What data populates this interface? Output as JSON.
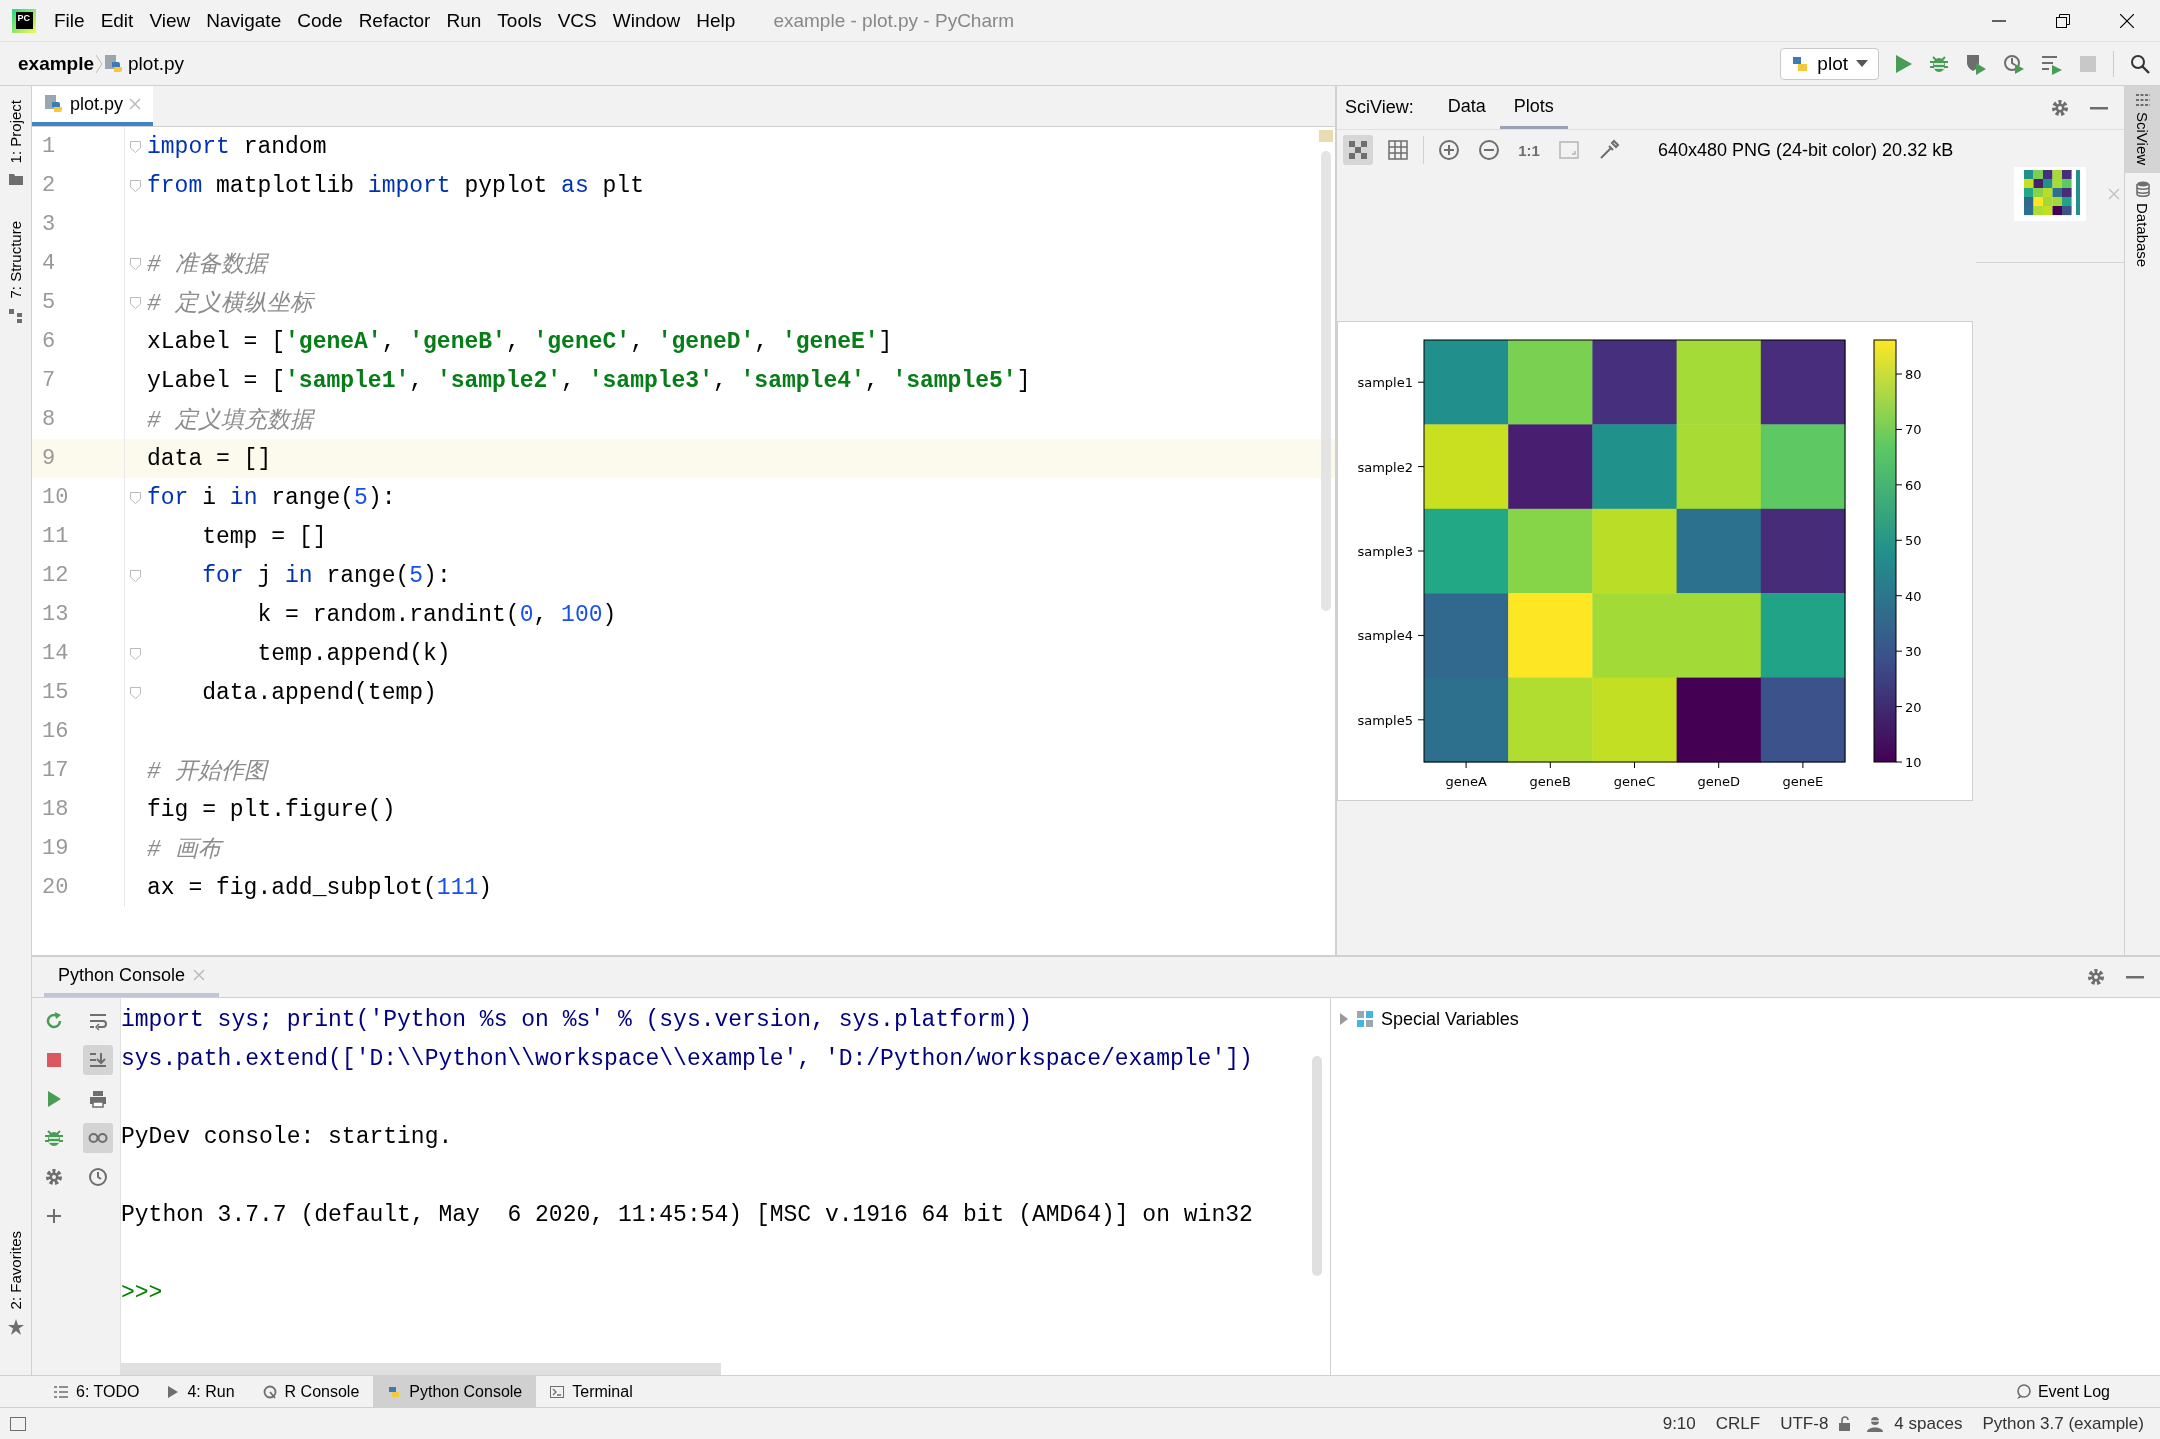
{
  "window": {
    "title": "example - plot.py - PyCharm",
    "app_icon": "PC"
  },
  "menu": [
    "File",
    "Edit",
    "View",
    "Navigate",
    "Code",
    "Refactor",
    "Run",
    "Tools",
    "VCS",
    "Window",
    "Help"
  ],
  "breadcrumb": {
    "project": "example",
    "file": "plot.py"
  },
  "run_config": {
    "label": "plot"
  },
  "left_strip": {
    "top": [
      "1: Project",
      "7: Structure"
    ],
    "bottom": [
      "2: Favorites"
    ]
  },
  "right_strip": [
    {
      "label": "SciView",
      "selected": true
    },
    {
      "label": "Database",
      "selected": false
    }
  ],
  "editor": {
    "tab": {
      "label": "plot.py"
    },
    "lines": [
      {
        "number": "1",
        "fold": true,
        "current": false,
        "tokens": [
          {
            "kind": "keyword",
            "text": "import"
          },
          {
            "kind": "plain",
            "text": " random"
          }
        ]
      },
      {
        "number": "2",
        "fold": true,
        "current": false,
        "tokens": [
          {
            "kind": "keyword",
            "text": "from"
          },
          {
            "kind": "plain",
            "text": " matplotlib "
          },
          {
            "kind": "keyword",
            "text": "import"
          },
          {
            "kind": "plain",
            "text": " pyplot "
          },
          {
            "kind": "keyword",
            "text": "as"
          },
          {
            "kind": "plain",
            "text": " plt"
          }
        ]
      },
      {
        "number": "3",
        "fold": false,
        "current": false
      },
      {
        "number": "4",
        "fold": true,
        "current": false,
        "tokens": [
          {
            "kind": "comment",
            "text": "# 准备数据"
          }
        ]
      },
      {
        "number": "5",
        "fold": true,
        "current": false,
        "tokens": [
          {
            "kind": "comment",
            "text": "# 定义横纵坐标"
          }
        ]
      },
      {
        "number": "6",
        "fold": false,
        "current": false,
        "tokens": [
          {
            "kind": "plain",
            "text": "xLabel = ["
          },
          {
            "kind": "string",
            "text": "'geneA'"
          },
          {
            "kind": "plain",
            "text": ", "
          },
          {
            "kind": "string",
            "text": "'geneB'"
          },
          {
            "kind": "plain",
            "text": ", "
          },
          {
            "kind": "string",
            "text": "'geneC'"
          },
          {
            "kind": "plain",
            "text": ", "
          },
          {
            "kind": "string",
            "text": "'geneD'"
          },
          {
            "kind": "plain",
            "text": ", "
          },
          {
            "kind": "string",
            "text": "'geneE'"
          },
          {
            "kind": "plain",
            "text": "]"
          }
        ]
      },
      {
        "number": "7",
        "fold": false,
        "current": false,
        "tokens": [
          {
            "kind": "plain",
            "text": "yLabel = ["
          },
          {
            "kind": "string",
            "text": "'sample1'"
          },
          {
            "kind": "plain",
            "text": ", "
          },
          {
            "kind": "string",
            "text": "'sample2'"
          },
          {
            "kind": "plain",
            "text": ", "
          },
          {
            "kind": "string",
            "text": "'sample3'"
          },
          {
            "kind": "plain",
            "text": ", "
          },
          {
            "kind": "string",
            "text": "'sample4'"
          },
          {
            "kind": "plain",
            "text": ", "
          },
          {
            "kind": "string",
            "text": "'sample5'"
          },
          {
            "kind": "plain",
            "text": "]"
          }
        ]
      },
      {
        "number": "8",
        "fold": false,
        "current": false,
        "tokens": [
          {
            "kind": "comment",
            "text": "# 定义填充数据"
          }
        ]
      },
      {
        "number": "9",
        "fold": false,
        "current": true,
        "tokens": [
          {
            "kind": "plain",
            "text": "data = []"
          }
        ]
      },
      {
        "number": "10",
        "fold": true,
        "current": false,
        "tokens": [
          {
            "kind": "keyword",
            "text": "for"
          },
          {
            "kind": "plain",
            "text": " i "
          },
          {
            "kind": "keyword",
            "text": "in"
          },
          {
            "kind": "plain",
            "text": " range("
          },
          {
            "kind": "number",
            "text": "5"
          },
          {
            "kind": "plain",
            "text": "):"
          }
        ]
      },
      {
        "number": "11",
        "fold": false,
        "current": false,
        "tokens": [
          {
            "kind": "plain",
            "text": "    temp = []"
          }
        ]
      },
      {
        "number": "12",
        "fold": true,
        "current": false,
        "tokens": [
          {
            "kind": "keyword",
            "text": "    for"
          },
          {
            "kind": "plain",
            "text": " j "
          },
          {
            "kind": "keyword",
            "text": "in"
          },
          {
            "kind": "plain",
            "text": " range("
          },
          {
            "kind": "number",
            "text": "5"
          },
          {
            "kind": "plain",
            "text": "):"
          }
        ]
      },
      {
        "number": "13",
        "fold": false,
        "current": false,
        "tokens": [
          {
            "kind": "plain",
            "text": "        k = random.randint("
          },
          {
            "kind": "number",
            "text": "0"
          },
          {
            "kind": "plain",
            "text": ", "
          },
          {
            "kind": "number",
            "text": "100"
          },
          {
            "kind": "plain",
            "text": ")"
          }
        ]
      },
      {
        "number": "14",
        "fold": true,
        "current": false,
        "tokens": [
          {
            "kind": "plain",
            "text": "        temp.append(k)"
          }
        ]
      },
      {
        "number": "15",
        "fold": true,
        "current": false,
        "tokens": [
          {
            "kind": "plain",
            "text": "    data.append(temp)"
          }
        ]
      },
      {
        "number": "16",
        "fold": false,
        "current": false
      },
      {
        "number": "17",
        "fold": false,
        "current": false,
        "tokens": [
          {
            "kind": "comment",
            "text": "# 开始作图"
          }
        ]
      },
      {
        "number": "18",
        "fold": false,
        "current": false,
        "tokens": [
          {
            "kind": "plain",
            "text": "fig = plt.figure()"
          }
        ]
      },
      {
        "number": "19",
        "fold": false,
        "current": false,
        "tokens": [
          {
            "kind": "comment",
            "text": "# 画布"
          }
        ]
      },
      {
        "number": "20",
        "fold": false,
        "current": false,
        "tokens": [
          {
            "kind": "plain",
            "text": "ax = fig.add_subplot("
          },
          {
            "kind": "number",
            "text": "111"
          },
          {
            "kind": "plain",
            "text": ")"
          }
        ]
      }
    ]
  },
  "sciview": {
    "label": "SciView:",
    "tabs": [
      {
        "label": "Data",
        "selected": false
      },
      {
        "label": "Plots",
        "selected": true
      }
    ],
    "tools": [
      {
        "kind": "fit",
        "on": true,
        "disabled": false
      },
      {
        "kind": "grid",
        "on": false,
        "disabled": false
      },
      {
        "kind": "zoom-in",
        "on": false,
        "disabled": false
      },
      {
        "kind": "zoom-out",
        "on": false,
        "disabled": false
      },
      {
        "kind": "actual-size",
        "label": "1:1",
        "on": false,
        "disabled": false
      },
      {
        "kind": "frame",
        "on": false,
        "disabled": true
      },
      {
        "kind": "picker",
        "on": false,
        "disabled": false
      }
    ],
    "image_info": "640x480 PNG (24-bit color) 20.32 kB",
    "plot": {
      "x_labels": [
        "geneA",
        "geneB",
        "geneC",
        "geneD",
        "geneE"
      ],
      "rows": [
        {
          "label": "sample1",
          "cells": [
            {
              "color": "#21908d"
            },
            {
              "color": "#7ad151"
            },
            {
              "color": "#46307e"
            },
            {
              "color": "#a5db36"
            },
            {
              "color": "#472d7b"
            }
          ]
        },
        {
          "label": "sample2",
          "cells": [
            {
              "color": "#c8e020"
            },
            {
              "color": "#481f70"
            },
            {
              "color": "#21918c"
            },
            {
              "color": "#a8db34"
            },
            {
              "color": "#5ec962"
            }
          ]
        },
        {
          "label": "sample3",
          "cells": [
            {
              "color": "#22a884"
            },
            {
              "color": "#86d549"
            },
            {
              "color": "#bade28"
            },
            {
              "color": "#2c728e"
            },
            {
              "color": "#472c7a"
            }
          ]
        },
        {
          "label": "sample4",
          "cells": [
            {
              "color": "#31688e"
            },
            {
              "color": "#fde725"
            },
            {
              "color": "#a2da37"
            },
            {
              "color": "#a2da37"
            },
            {
              "color": "#20a386"
            }
          ]
        },
        {
          "label": "sample5",
          "cells": [
            {
              "color": "#2d708e"
            },
            {
              "color": "#b0dd2f"
            },
            {
              "color": "#c2df23"
            },
            {
              "color": "#440154"
            },
            {
              "color": "#3b528b"
            }
          ]
        }
      ],
      "colorbar_ticks": [
        "80",
        "70",
        "60",
        "50",
        "40",
        "30",
        "20",
        "10"
      ]
    }
  },
  "console": {
    "tab": {
      "label": "Python Console"
    },
    "left_tools": [
      {
        "kind": "rerun"
      },
      {
        "kind": "stop"
      },
      {
        "kind": "run"
      },
      {
        "kind": "debug"
      },
      {
        "kind": "settings"
      },
      {
        "kind": "add"
      }
    ],
    "right_tools": [
      {
        "kind": "wrap",
        "on": false
      },
      {
        "kind": "scroll-end",
        "on": true
      },
      {
        "kind": "print",
        "on": false
      },
      {
        "kind": "glasses",
        "on": true
      },
      {
        "kind": "history",
        "on": false
      }
    ],
    "lines": [
      {
        "kind": "input",
        "text": "import sys; print('Python %s on %s' % (sys.version, sys.platform))"
      },
      {
        "kind": "input",
        "text": "sys.path.extend(['D:\\\\Python\\\\workspace\\\\example', 'D:/Python/workspace/example'])"
      },
      {
        "kind": "blank"
      },
      {
        "kind": "output",
        "text": "PyDev console: starting."
      },
      {
        "kind": "blank"
      },
      {
        "kind": "output",
        "text": "Python 3.7.7 (default, May  6 2020, 11:45:54) [MSC v.1916 64 bit (AMD64)] on win32"
      },
      {
        "kind": "blank"
      },
      {
        "kind": "prompt",
        "text": ">>>"
      }
    ],
    "variables": [
      {
        "label": "Special Variables",
        "expanded": false
      }
    ]
  },
  "tool_buttons": [
    {
      "kind": "todo",
      "label": "6: TODO",
      "selected": false
    },
    {
      "kind": "run",
      "label": "4: Run",
      "selected": false
    },
    {
      "kind": "r",
      "label": "R Console",
      "selected": false
    },
    {
      "kind": "python",
      "label": "Python Console",
      "selected": true
    },
    {
      "kind": "terminal",
      "label": "Terminal",
      "selected": false
    }
  ],
  "event_log": "Event Log",
  "status_bar": {
    "position": "9:10",
    "line_ending": "CRLF",
    "encoding": "UTF-8",
    "indent": "4 spaces",
    "interpreter": "Python 3.7 (example)"
  }
}
